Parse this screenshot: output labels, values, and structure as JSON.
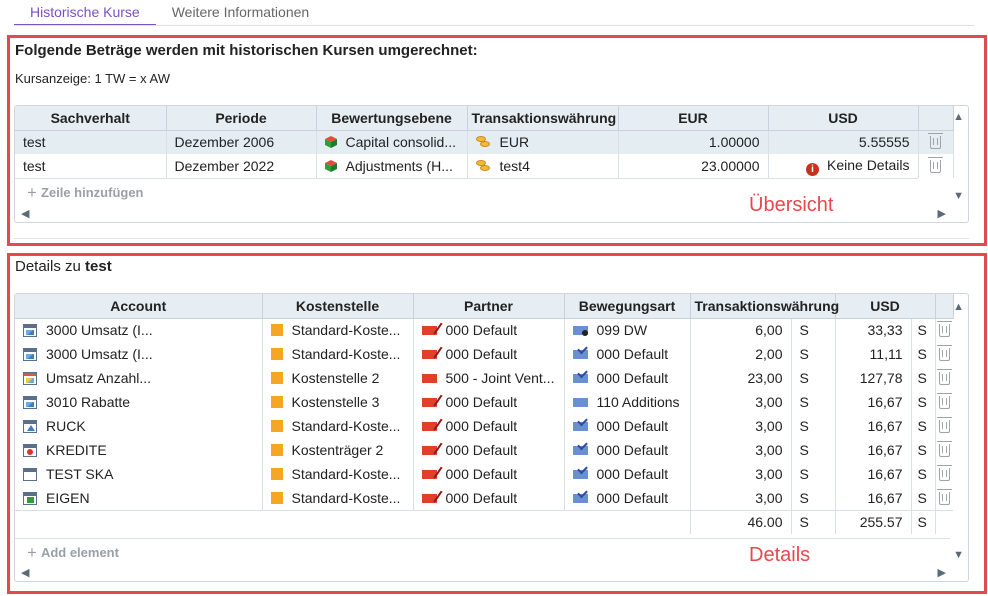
{
  "tabs": [
    {
      "label": "Historische Kurse",
      "active": true
    },
    {
      "label": "Weitere Informationen",
      "active": false
    }
  ],
  "overview": {
    "heading": "Folgende Beträge werden mit historischen Kursen umgerechnet:",
    "rate_display": "Kursanzeige: 1 TW = x AW",
    "columns": [
      "Sachverhalt",
      "Periode",
      "Bewertungsebene",
      "Transaktionswährung",
      "EUR",
      "USD"
    ],
    "rows": [
      {
        "sachverhalt": "test",
        "periode": "Dezember 2006",
        "ebene": "Capital consolid...",
        "ebene_icon": "cube-icon",
        "waehrung": "EUR",
        "waehrung_icon": "coins-icon",
        "eur": "1.00000",
        "usd": "5.55555",
        "selected": true
      },
      {
        "sachverhalt": "test",
        "periode": "Dezember 2022",
        "ebene": "Adjustments (H...",
        "ebene_icon": "cube-icon",
        "waehrung": "test4",
        "waehrung_icon": "coins-icon",
        "eur": "23.00000",
        "usd": "Keine Details",
        "usd_icon": "info-icon",
        "selected": false
      }
    ],
    "add_row": "Zeile hinzufügen",
    "annotation": "Übersicht"
  },
  "details": {
    "title_prefix": "Details zu",
    "title_subject": "test",
    "columns": [
      "Account",
      "Kostenstelle",
      "Partner",
      "Bewegungsart",
      "Transaktionswährung",
      "USD"
    ],
    "rows": [
      {
        "account": "3000 Umsatz (I...",
        "account_icon": "account-image-icon",
        "kostenstelle": "Standard-Koste...",
        "partner": "000 Default",
        "partner_icon": "flag-icon",
        "bewegung": "099 DW",
        "bewegung_icon": "movement-gear-icon",
        "tw": "6,00",
        "tw_sign": "S",
        "usd": "33,33",
        "usd_sign": "S"
      },
      {
        "account": "3000 Umsatz (I...",
        "account_icon": "account-image-icon",
        "kostenstelle": "Standard-Koste...",
        "partner": "000 Default",
        "partner_icon": "flag-icon",
        "bewegung": "000 Default",
        "bewegung_icon": "movement-check-icon",
        "tw": "2,00",
        "tw_sign": "S",
        "usd": "11,11",
        "usd_sign": "S"
      },
      {
        "account": "Umsatz Anzahl...",
        "account_icon": "account-red-icon",
        "kostenstelle": "Kostenstelle 2",
        "partner": "500 - Joint Vent...",
        "partner_icon": "flag-plain-icon",
        "bewegung": "000 Default",
        "bewegung_icon": "movement-check-icon",
        "tw": "23,00",
        "tw_sign": "S",
        "usd": "127,78",
        "usd_sign": "S"
      },
      {
        "account": "3010 Rabatte",
        "account_icon": "account-image-icon",
        "kostenstelle": "Kostenstelle 3",
        "partner": "000 Default",
        "partner_icon": "flag-icon",
        "bewegung": "110 Additions",
        "bewegung_icon": "movement-plain-icon",
        "tw": "3,00",
        "tw_sign": "S",
        "usd": "16,67",
        "usd_sign": "S"
      },
      {
        "account": "RUCK",
        "account_icon": "account-triangle-icon",
        "kostenstelle": "Standard-Koste...",
        "partner": "000 Default",
        "partner_icon": "flag-icon",
        "bewegung": "000 Default",
        "bewegung_icon": "movement-check-icon",
        "tw": "3,00",
        "tw_sign": "S",
        "usd": "16,67",
        "usd_sign": "S"
      },
      {
        "account": "KREDITE",
        "account_icon": "account-dot-icon",
        "kostenstelle": "Kostenträger 2",
        "partner": "000 Default",
        "partner_icon": "flag-icon",
        "bewegung": "000 Default",
        "bewegung_icon": "movement-check-icon",
        "tw": "3,00",
        "tw_sign": "S",
        "usd": "16,67",
        "usd_sign": "S"
      },
      {
        "account": "TEST SKA",
        "account_icon": "account-blank-icon",
        "kostenstelle": "Standard-Koste...",
        "partner": "000 Default",
        "partner_icon": "flag-icon",
        "bewegung": "000 Default",
        "bewegung_icon": "movement-check-icon",
        "tw": "3,00",
        "tw_sign": "S",
        "usd": "16,67",
        "usd_sign": "S"
      },
      {
        "account": "EIGEN",
        "account_icon": "account-green-icon",
        "kostenstelle": "Standard-Koste...",
        "partner": "000 Default",
        "partner_icon": "flag-icon",
        "bewegung": "000 Default",
        "bewegung_icon": "movement-check-icon",
        "tw": "3,00",
        "tw_sign": "S",
        "usd": "16,67",
        "usd_sign": "S"
      }
    ],
    "totals": {
      "tw": "46.00",
      "tw_sign": "S",
      "usd": "255.57",
      "usd_sign": "S"
    },
    "add_element": "Add element",
    "annotation": "Details"
  },
  "colors": {
    "accent": "#7a4fc7",
    "annotation": "#e5484d",
    "header_bg": "#e6eef3",
    "selected_row": "#e4edf2"
  }
}
